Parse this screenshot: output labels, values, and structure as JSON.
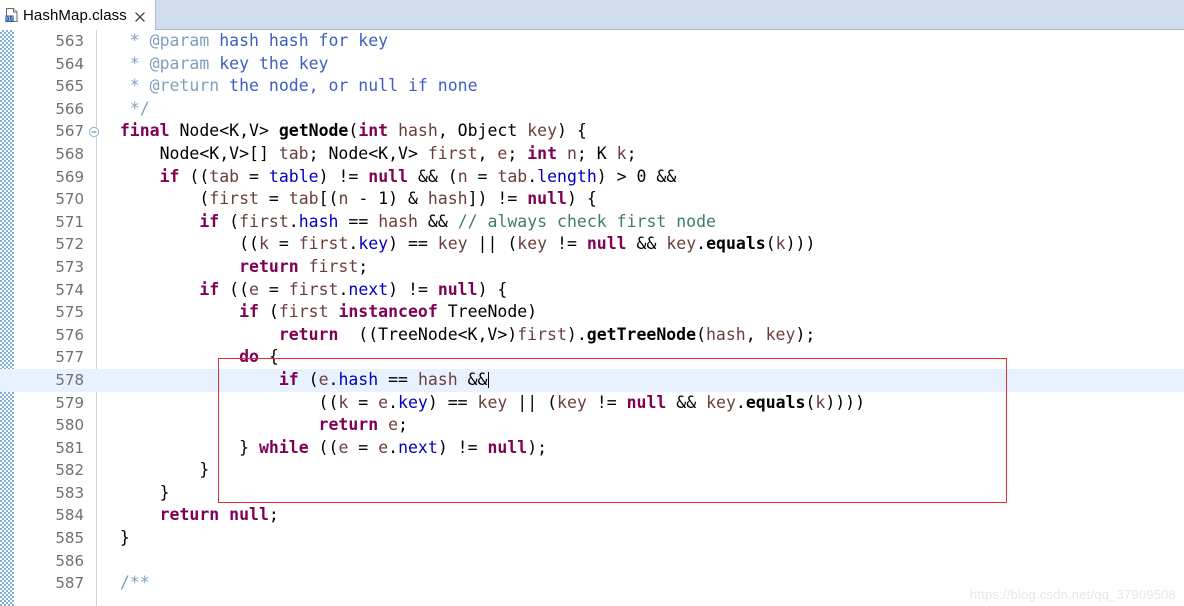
{
  "window": {
    "tab": {
      "title": "HashMap.class",
      "icon": "class-file-icon",
      "close_icon": "close-icon",
      "active": true
    }
  },
  "editor": {
    "current_line": 578,
    "caret_line": 578,
    "folding_lines": [
      567
    ],
    "annotation": {
      "shape": "rectangle",
      "color": "#e33131"
    },
    "colors": {
      "keyword": "#7f0055",
      "field": "#0000c0",
      "parameter": "#6a3e3e",
      "comment": "#3f7f5f",
      "javadoc": "#3f5fbf",
      "javadoc_tag": "#7f9fbf",
      "current_line_highlight": "#e8f2fe",
      "tabbar_background": "#cfdcec",
      "annotation_ruler": "#6ba3d6"
    },
    "lines": [
      {
        "num": "563",
        "fold": "",
        "tokens": [
          {
            "t": "   * ",
            "c": "jtag"
          },
          {
            "t": "@param",
            "c": "jtag"
          },
          {
            "t": " ",
            "c": "jdoc"
          },
          {
            "t": "hash hash for key",
            "c": "jdoc"
          }
        ]
      },
      {
        "num": "564",
        "fold": "",
        "tokens": [
          {
            "t": "   * ",
            "c": "jtag"
          },
          {
            "t": "@param",
            "c": "jtag"
          },
          {
            "t": " ",
            "c": "jdoc"
          },
          {
            "t": "key the key",
            "c": "jdoc"
          }
        ]
      },
      {
        "num": "565",
        "fold": "",
        "tokens": [
          {
            "t": "   * ",
            "c": "jtag"
          },
          {
            "t": "@return",
            "c": "jtag"
          },
          {
            "t": " ",
            "c": "jdoc"
          },
          {
            "t": "the node, or null if none",
            "c": "jdoc"
          }
        ]
      },
      {
        "num": "566",
        "fold": "",
        "tokens": [
          {
            "t": "   */",
            "c": "jtag"
          }
        ]
      },
      {
        "num": "567",
        "fold": "⊖",
        "tokens": [
          {
            "t": "  ",
            "c": "plain"
          },
          {
            "t": "final",
            "c": "kw"
          },
          {
            "t": " Node<K,V> ",
            "c": "plain"
          },
          {
            "t": "getNode",
            "c": "mth"
          },
          {
            "t": "(",
            "c": "plain"
          },
          {
            "t": "int",
            "c": "kw"
          },
          {
            "t": " ",
            "c": "plain"
          },
          {
            "t": "hash",
            "c": "prm"
          },
          {
            "t": ", Object ",
            "c": "plain"
          },
          {
            "t": "key",
            "c": "prm"
          },
          {
            "t": ") {",
            "c": "plain"
          }
        ]
      },
      {
        "num": "568",
        "fold": "",
        "tokens": [
          {
            "t": "      Node<K,V>[] ",
            "c": "plain"
          },
          {
            "t": "tab",
            "c": "prm"
          },
          {
            "t": "; Node<K,V> ",
            "c": "plain"
          },
          {
            "t": "first",
            "c": "prm"
          },
          {
            "t": ", ",
            "c": "plain"
          },
          {
            "t": "e",
            "c": "prm"
          },
          {
            "t": "; ",
            "c": "plain"
          },
          {
            "t": "int",
            "c": "kw"
          },
          {
            "t": " ",
            "c": "plain"
          },
          {
            "t": "n",
            "c": "prm"
          },
          {
            "t": "; K ",
            "c": "plain"
          },
          {
            "t": "k",
            "c": "prm"
          },
          {
            "t": ";",
            "c": "plain"
          }
        ]
      },
      {
        "num": "569",
        "fold": "",
        "tokens": [
          {
            "t": "      ",
            "c": "plain"
          },
          {
            "t": "if",
            "c": "kw"
          },
          {
            "t": " ((",
            "c": "plain"
          },
          {
            "t": "tab",
            "c": "prm"
          },
          {
            "t": " = ",
            "c": "plain"
          },
          {
            "t": "table",
            "c": "fld"
          },
          {
            "t": ") != ",
            "c": "plain"
          },
          {
            "t": "null",
            "c": "kw"
          },
          {
            "t": " && (",
            "c": "plain"
          },
          {
            "t": "n",
            "c": "prm"
          },
          {
            "t": " = ",
            "c": "plain"
          },
          {
            "t": "tab",
            "c": "prm"
          },
          {
            "t": ".",
            "c": "plain"
          },
          {
            "t": "length",
            "c": "fld"
          },
          {
            "t": ") > 0 &&",
            "c": "plain"
          }
        ]
      },
      {
        "num": "570",
        "fold": "",
        "tokens": [
          {
            "t": "          (",
            "c": "plain"
          },
          {
            "t": "first",
            "c": "prm"
          },
          {
            "t": " = ",
            "c": "plain"
          },
          {
            "t": "tab",
            "c": "prm"
          },
          {
            "t": "[(",
            "c": "plain"
          },
          {
            "t": "n",
            "c": "prm"
          },
          {
            "t": " - 1) & ",
            "c": "plain"
          },
          {
            "t": "hash",
            "c": "prm"
          },
          {
            "t": "]) != ",
            "c": "plain"
          },
          {
            "t": "null",
            "c": "kw"
          },
          {
            "t": ") {",
            "c": "plain"
          }
        ]
      },
      {
        "num": "571",
        "fold": "",
        "tokens": [
          {
            "t": "          ",
            "c": "plain"
          },
          {
            "t": "if",
            "c": "kw"
          },
          {
            "t": " (",
            "c": "plain"
          },
          {
            "t": "first",
            "c": "prm"
          },
          {
            "t": ".",
            "c": "plain"
          },
          {
            "t": "hash",
            "c": "fld"
          },
          {
            "t": " == ",
            "c": "plain"
          },
          {
            "t": "hash",
            "c": "prm"
          },
          {
            "t": " && ",
            "c": "plain"
          },
          {
            "t": "// always check first node",
            "c": "cmt"
          }
        ]
      },
      {
        "num": "572",
        "fold": "",
        "tokens": [
          {
            "t": "              ((",
            "c": "plain"
          },
          {
            "t": "k",
            "c": "prm"
          },
          {
            "t": " = ",
            "c": "plain"
          },
          {
            "t": "first",
            "c": "prm"
          },
          {
            "t": ".",
            "c": "plain"
          },
          {
            "t": "key",
            "c": "fld"
          },
          {
            "t": ") == ",
            "c": "plain"
          },
          {
            "t": "key",
            "c": "prm"
          },
          {
            "t": " || (",
            "c": "plain"
          },
          {
            "t": "key",
            "c": "prm"
          },
          {
            "t": " != ",
            "c": "plain"
          },
          {
            "t": "null",
            "c": "kw"
          },
          {
            "t": " && ",
            "c": "plain"
          },
          {
            "t": "key",
            "c": "prm"
          },
          {
            "t": ".",
            "c": "plain"
          },
          {
            "t": "equals",
            "c": "mth"
          },
          {
            "t": "(",
            "c": "plain"
          },
          {
            "t": "k",
            "c": "prm"
          },
          {
            "t": ")))",
            "c": "plain"
          }
        ]
      },
      {
        "num": "573",
        "fold": "",
        "tokens": [
          {
            "t": "              ",
            "c": "plain"
          },
          {
            "t": "return",
            "c": "kw"
          },
          {
            "t": " ",
            "c": "plain"
          },
          {
            "t": "first",
            "c": "prm"
          },
          {
            "t": ";",
            "c": "plain"
          }
        ]
      },
      {
        "num": "574",
        "fold": "",
        "tokens": [
          {
            "t": "          ",
            "c": "plain"
          },
          {
            "t": "if",
            "c": "kw"
          },
          {
            "t": " ((",
            "c": "plain"
          },
          {
            "t": "e",
            "c": "prm"
          },
          {
            "t": " = ",
            "c": "plain"
          },
          {
            "t": "first",
            "c": "prm"
          },
          {
            "t": ".",
            "c": "plain"
          },
          {
            "t": "next",
            "c": "fld"
          },
          {
            "t": ") != ",
            "c": "plain"
          },
          {
            "t": "null",
            "c": "kw"
          },
          {
            "t": ") {",
            "c": "plain"
          }
        ]
      },
      {
        "num": "575",
        "fold": "",
        "tokens": [
          {
            "t": "              ",
            "c": "plain"
          },
          {
            "t": "if",
            "c": "kw"
          },
          {
            "t": " (",
            "c": "plain"
          },
          {
            "t": "first",
            "c": "prm"
          },
          {
            "t": " ",
            "c": "plain"
          },
          {
            "t": "instanceof",
            "c": "kw"
          },
          {
            "t": " TreeNode)",
            "c": "plain"
          }
        ]
      },
      {
        "num": "576",
        "fold": "",
        "tokens": [
          {
            "t": "                  ",
            "c": "plain"
          },
          {
            "t": "return",
            "c": "kw"
          },
          {
            "t": "  ((TreeNode<K,V>)",
            "c": "plain"
          },
          {
            "t": "first",
            "c": "prm"
          },
          {
            "t": ").",
            "c": "plain"
          },
          {
            "t": "getTreeNode",
            "c": "mth"
          },
          {
            "t": "(",
            "c": "plain"
          },
          {
            "t": "hash",
            "c": "prm"
          },
          {
            "t": ", ",
            "c": "plain"
          },
          {
            "t": "key",
            "c": "prm"
          },
          {
            "t": ");",
            "c": "plain"
          }
        ]
      },
      {
        "num": "577",
        "fold": "",
        "tokens": [
          {
            "t": "              ",
            "c": "plain"
          },
          {
            "t": "do",
            "c": "kw"
          },
          {
            "t": " {",
            "c": "plain"
          }
        ]
      },
      {
        "num": "578",
        "fold": "",
        "current": true,
        "caret": true,
        "tokens": [
          {
            "t": "                  ",
            "c": "plain"
          },
          {
            "t": "if",
            "c": "kw"
          },
          {
            "t": " (",
            "c": "plain"
          },
          {
            "t": "e",
            "c": "prm"
          },
          {
            "t": ".",
            "c": "plain"
          },
          {
            "t": "hash",
            "c": "fld"
          },
          {
            "t": " == ",
            "c": "plain"
          },
          {
            "t": "hash",
            "c": "prm"
          },
          {
            "t": " &&",
            "c": "plain"
          }
        ]
      },
      {
        "num": "579",
        "fold": "",
        "tokens": [
          {
            "t": "                      ((",
            "c": "plain"
          },
          {
            "t": "k",
            "c": "prm"
          },
          {
            "t": " = ",
            "c": "plain"
          },
          {
            "t": "e",
            "c": "prm"
          },
          {
            "t": ".",
            "c": "plain"
          },
          {
            "t": "key",
            "c": "fld"
          },
          {
            "t": ") == ",
            "c": "plain"
          },
          {
            "t": "key",
            "c": "prm"
          },
          {
            "t": " || (",
            "c": "plain"
          },
          {
            "t": "key",
            "c": "prm"
          },
          {
            "t": " != ",
            "c": "plain"
          },
          {
            "t": "null",
            "c": "kw"
          },
          {
            "t": " && ",
            "c": "plain"
          },
          {
            "t": "key",
            "c": "prm"
          },
          {
            "t": ".",
            "c": "plain"
          },
          {
            "t": "equals",
            "c": "mth"
          },
          {
            "t": "(",
            "c": "plain"
          },
          {
            "t": "k",
            "c": "prm"
          },
          {
            "t": "))))",
            "c": "plain"
          }
        ]
      },
      {
        "num": "580",
        "fold": "",
        "tokens": [
          {
            "t": "                      ",
            "c": "plain"
          },
          {
            "t": "return",
            "c": "kw"
          },
          {
            "t": " ",
            "c": "plain"
          },
          {
            "t": "e",
            "c": "prm"
          },
          {
            "t": ";",
            "c": "plain"
          }
        ]
      },
      {
        "num": "581",
        "fold": "",
        "tokens": [
          {
            "t": "              } ",
            "c": "plain"
          },
          {
            "t": "while",
            "c": "kw"
          },
          {
            "t": " ((",
            "c": "plain"
          },
          {
            "t": "e",
            "c": "prm"
          },
          {
            "t": " = ",
            "c": "plain"
          },
          {
            "t": "e",
            "c": "prm"
          },
          {
            "t": ".",
            "c": "plain"
          },
          {
            "t": "next",
            "c": "fld"
          },
          {
            "t": ") != ",
            "c": "plain"
          },
          {
            "t": "null",
            "c": "kw"
          },
          {
            "t": ");",
            "c": "plain"
          }
        ]
      },
      {
        "num": "582",
        "fold": "",
        "tokens": [
          {
            "t": "          }",
            "c": "plain"
          }
        ]
      },
      {
        "num": "583",
        "fold": "",
        "tokens": [
          {
            "t": "      }",
            "c": "plain"
          }
        ]
      },
      {
        "num": "584",
        "fold": "",
        "tokens": [
          {
            "t": "      ",
            "c": "plain"
          },
          {
            "t": "return",
            "c": "kw"
          },
          {
            "t": " ",
            "c": "plain"
          },
          {
            "t": "null",
            "c": "kw"
          },
          {
            "t": ";",
            "c": "plain"
          }
        ]
      },
      {
        "num": "585",
        "fold": "",
        "tokens": [
          {
            "t": "  }",
            "c": "plain"
          }
        ]
      },
      {
        "num": "586",
        "fold": "",
        "tokens": []
      },
      {
        "num": "587",
        "fold": "",
        "tokens": [
          {
            "t": "  /**",
            "c": "jtag"
          }
        ]
      }
    ]
  },
  "watermark": {
    "text": "https://blog.csdn.net/qq_37909508"
  }
}
